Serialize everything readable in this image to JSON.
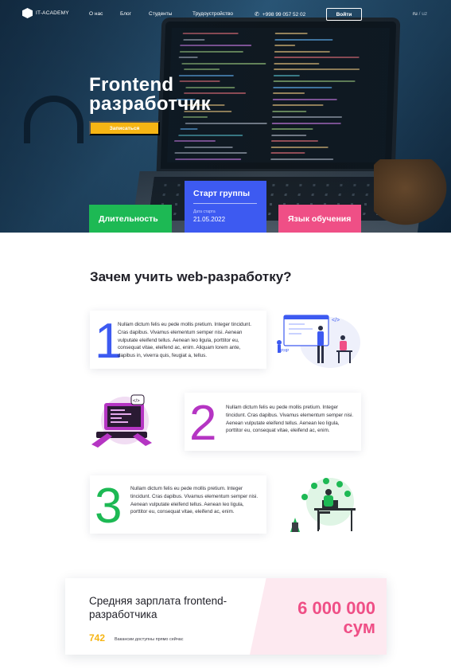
{
  "nav": {
    "logo": "IT-ACADEMY",
    "links": [
      "О нас",
      "Блог",
      "Студенты",
      "Трудоустройство"
    ],
    "phone": "+998 99 057 52 02",
    "login": "Войти",
    "lang_active": "ru",
    "lang_sep": "/",
    "lang_other": "uz"
  },
  "hero": {
    "title_line1": "Frontend",
    "title_line2": "разработчик",
    "signup": "Записаться"
  },
  "cards": {
    "duration": "Длительность",
    "start_title": "Старт группы",
    "start_label": "Дата старта",
    "start_date": "21.05.2022",
    "language": "Язык обучения"
  },
  "why": {
    "title": "Зачем учить web-разработку?",
    "reasons": [
      {
        "num": "1",
        "text": "Nullam dictum felis eu pede mollis pretium. Integer tincidunt. Cras dapibus. Vivamus elementum semper nisi. Aenean vulputate eleifend tellus. Aenean leo ligula, porttitor eu, consequat vitae, eleifend ac, enim. Aliquam lorem ante, dapibus in, viverra quis, feugiat a, tellus."
      },
      {
        "num": "2",
        "text": "Nullam dictum felis eu pede mollis pretium. Integer tincidunt. Cras dapibus. Vivamus elementum semper nisi. Aenean vulputate eleifend tellus. Aenean leo ligula, porttitor eu, consequat vitae, eleifend ac, enim."
      },
      {
        "num": "3",
        "text": "Nullam dictum felis eu pede mollis pretium. Integer tincidunt. Cras dapibus. Vivamus elementum semper nisi. Aenean vulputate eleifend tellus. Aenean leo ligula, porttitor eu, consequat vitae, eleifend ac, enim."
      }
    ]
  },
  "salary": {
    "title": "Средняя зарплата frontend-разработчика",
    "amount_line1": "6 000 000",
    "amount_line2": "сум",
    "vacancies": "742",
    "vacancies_label": "Вакансии доступны прямо сейчас"
  },
  "colors": {
    "green": "#1db954",
    "blue": "#3d5af1",
    "pink": "#ef4f86",
    "yellow": "#f6b514",
    "purple": "#b535c3"
  },
  "icons": [
    "logo-icon",
    "phone-icon"
  ]
}
